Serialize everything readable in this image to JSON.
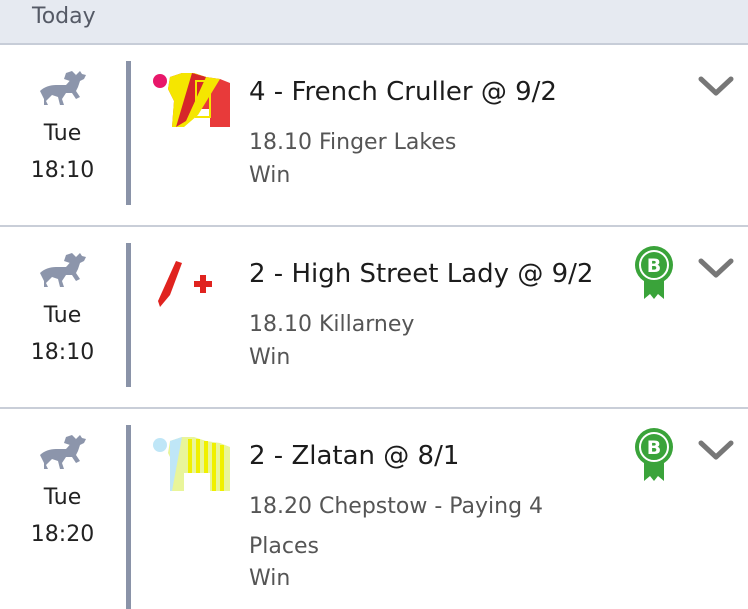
{
  "header": {
    "title": "Today"
  },
  "bets": [
    {
      "day": "Tue",
      "time": "18:10",
      "runner": "4 - French Cruller @ 9/2",
      "race": "18.10 Finger Lakes",
      "market": "Win",
      "boosted": false
    },
    {
      "day": "Tue",
      "time": "18:10",
      "runner": "2 - High Street Lady @ 9/2",
      "race": "18.10 Killarney",
      "market": "Win",
      "boosted": true,
      "badge_letter": "B"
    },
    {
      "day": "Tue",
      "time": "18:20",
      "runner": "2 - Zlatan @ 8/1",
      "race": "18.20 Chepstow - Paying 4 Places",
      "market": "Win",
      "boosted": true,
      "badge_letter": "B"
    }
  ],
  "colors": {
    "header_bg": "#e6eaf1",
    "divider": "#8a93a8",
    "horse_icon": "#8c95ab",
    "badge_green": "#3aa33a",
    "chevron": "#777777"
  }
}
